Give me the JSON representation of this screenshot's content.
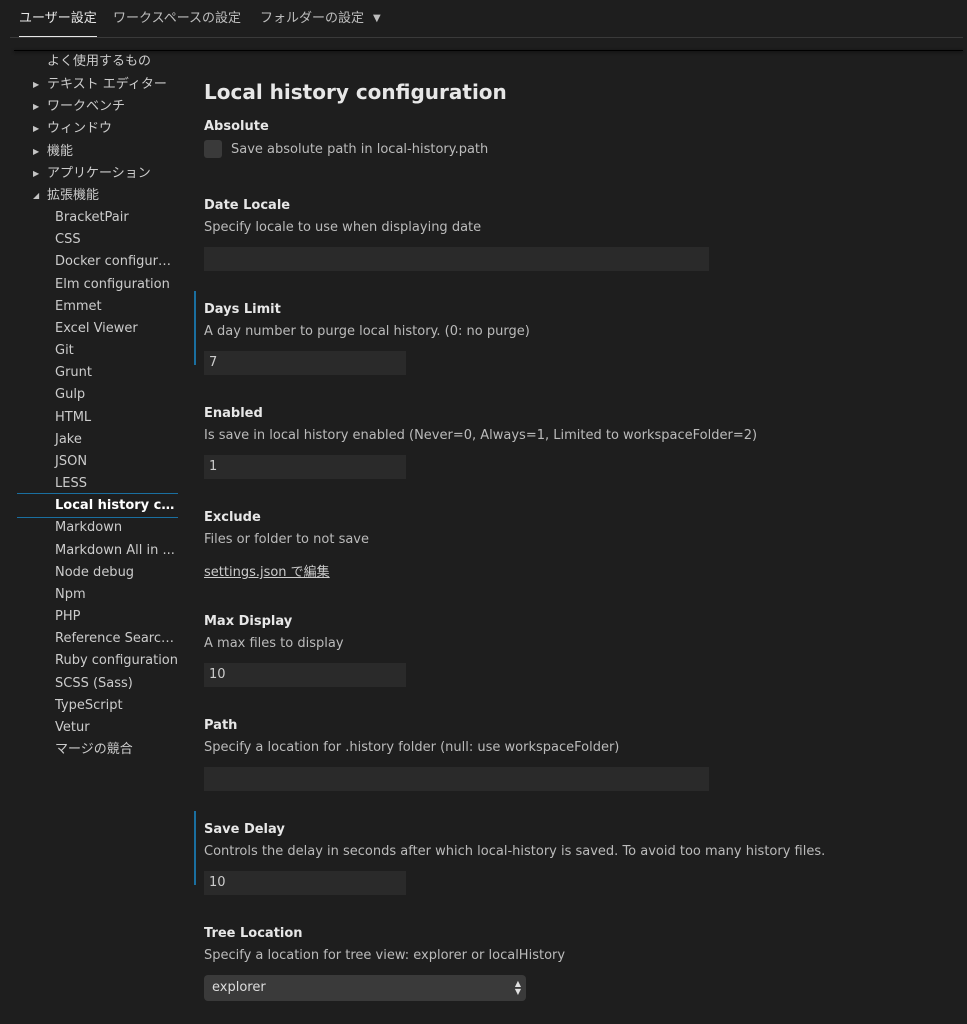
{
  "tabs": [
    {
      "label": "ユーザー設定"
    },
    {
      "label": "ワークスペースの設定"
    },
    {
      "label": "フォルダーの設定"
    }
  ],
  "nav": {
    "items": [
      {
        "label": "よく使用するもの"
      },
      {
        "label": "テキスト エディター"
      },
      {
        "label": "ワークベンチ"
      },
      {
        "label": "ウィンドウ"
      },
      {
        "label": "機能"
      },
      {
        "label": "アプリケーション"
      },
      {
        "label": "拡張機能"
      },
      {
        "label": "BracketPair"
      },
      {
        "label": "CSS"
      },
      {
        "label": "Docker configurat..."
      },
      {
        "label": "Elm configuration"
      },
      {
        "label": "Emmet"
      },
      {
        "label": "Excel Viewer"
      },
      {
        "label": "Git"
      },
      {
        "label": "Grunt"
      },
      {
        "label": "Gulp"
      },
      {
        "label": "HTML"
      },
      {
        "label": "Jake"
      },
      {
        "label": "JSON"
      },
      {
        "label": "LESS"
      },
      {
        "label": "Local history co..."
      },
      {
        "label": "Markdown"
      },
      {
        "label": "Markdown All in ..."
      },
      {
        "label": "Node debug"
      },
      {
        "label": "Npm"
      },
      {
        "label": "PHP"
      },
      {
        "label": "Reference Search..."
      },
      {
        "label": "Ruby configuration"
      },
      {
        "label": "SCSS (Sass)"
      },
      {
        "label": "TypeScript"
      },
      {
        "label": "Vetur"
      },
      {
        "label": "マージの競合"
      }
    ]
  },
  "page": {
    "title": "Local history configuration"
  },
  "settings": {
    "absolute": {
      "title": "Absolute",
      "checkbox_label": "Save absolute path in local-history.path",
      "checked": false
    },
    "date_locale": {
      "title": "Date Locale",
      "description": "Specify locale to use when displaying date",
      "value": ""
    },
    "days_limit": {
      "title": "Days Limit",
      "description": "A day number to purge local history. (0: no purge)",
      "value": "7"
    },
    "enabled": {
      "title": "Enabled",
      "description": "Is save in local history enabled (Never=0, Always=1, Limited to workspaceFolder=2)",
      "value": "1"
    },
    "exclude": {
      "title": "Exclude",
      "description": "Files or folder to not save",
      "link": "settings.json で編集"
    },
    "max_display": {
      "title": "Max Display",
      "description": "A max files to display",
      "value": "10"
    },
    "path": {
      "title": "Path",
      "description": "Specify a location for .history folder (null: use workspaceFolder)",
      "value": ""
    },
    "save_delay": {
      "title": "Save Delay",
      "description": "Controls the delay in seconds after which local-history is saved. To avoid too many history files.",
      "value": "10"
    },
    "tree_location": {
      "title": "Tree Location",
      "description": "Specify a location for tree view: explorer or localHistory",
      "selected": "explorer"
    }
  },
  "colors": {
    "background": "#1e1e1e",
    "accent": "#1a6fa0",
    "input_bg": "#2a2a2a"
  }
}
